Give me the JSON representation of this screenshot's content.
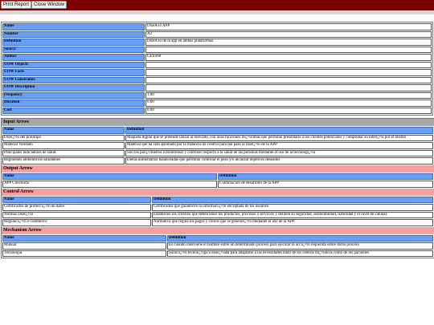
{
  "toolbar": {
    "print_label": "Print Report",
    "close_label": "Close Window"
  },
  "properties": [
    {
      "key": "Name",
      "value": "DiseÃ±o APP"
    },
    {
      "key": "Number",
      "value": "A2"
    },
    {
      "key": "Definition",
      "value": "DiseÃ±o de la app en ambas plataformas"
    },
    {
      "key": "Source",
      "value": ""
    },
    {
      "key": "Author",
      "value": "GESS68"
    },
    {
      "key": "UOW Objects",
      "value": ""
    },
    {
      "key": "UOW Facts",
      "value": ""
    },
    {
      "key": "UOW Constraints",
      "value": ""
    },
    {
      "key": "UOW Description",
      "value": ""
    },
    {
      "key": "Frequency",
      "value": "1.00"
    },
    {
      "key": "Duration",
      "value": "0.00"
    },
    {
      "key": "Cost",
      "value": "0.00"
    }
  ],
  "sections": {
    "input": {
      "title": "Input Arrow",
      "headers": [
        "Name",
        "Definition"
      ],
      "rows": [
        [
          "Diseï¿½o del prototipo",
          "Maqueta digital que se pretende lanzar al mercado, con unas funciones mï¿½nimas que permitan presentarle a los clientes potenciales y comprobar su interï¿½s por el mismo"
        ],
        [
          "Material Validado",
          "Material que ha sido aprobado por la instancia de control para dar paso al diseï¿½o de la APP"
        ],
        [
          "Principales indicadores de salud",
          "Son los parï¿½metros a monitorear y controlar respecto a la salud de las personas mediante el uso de la tecnologï¿½a"
        ],
        [
          "Regimenes alimenticios saludables",
          "Dietas alimentarias balanceadas que permitan controlar el peso y/o alcanzar objetivos deseados"
        ]
      ]
    },
    "output": {
      "title": "Output Arrow",
      "headers": [
        "Name",
        "Definition"
      ],
      "rows": [
        [
          "APP Concluida",
          "Culminacion de desarrollo de la APP"
        ]
      ]
    },
    "control": {
      "title": "Control Arrow",
      "headers": [
        "Name",
        "Definition"
      ],
      "rows": [
        [
          "Certificados de protecciï¿½n de datos",
          "Certificados que garanticen la informaciï¿½n encriptada de los usuarios"
        ],
        [
          "Normas Diseï¿½o",
          "Establecen los criterios que deben tener los productos, procesos o servicios y definen su seguridad, sostenibilidad, fiabilidad y el nivel de calidad."
        ],
        [
          "Regulaciï¿½n e-commerce",
          "Normativa que regula los pagos y cobros que se generarï¿½n mediante el uso de la APP."
        ]
      ]
    },
    "mechanism": {
      "title": "Mechanism Arrow",
      "headers": [
        "Name",
        "Definition"
      ],
      "rows": [
        [
          "Manual",
          "Es cuando interviene el hombre sobre un determinado proceso para ejecutar la acciï¿½n requerida sobre dicho proceso"
        ],
        [
          "Tecnologia",
          "Soluciï¿½n tecnolï¿½gica diseï¿½ada para adaptarse a las necesidades tanto de los centros mï¿½dicos como de los pacientes"
        ]
      ]
    }
  }
}
